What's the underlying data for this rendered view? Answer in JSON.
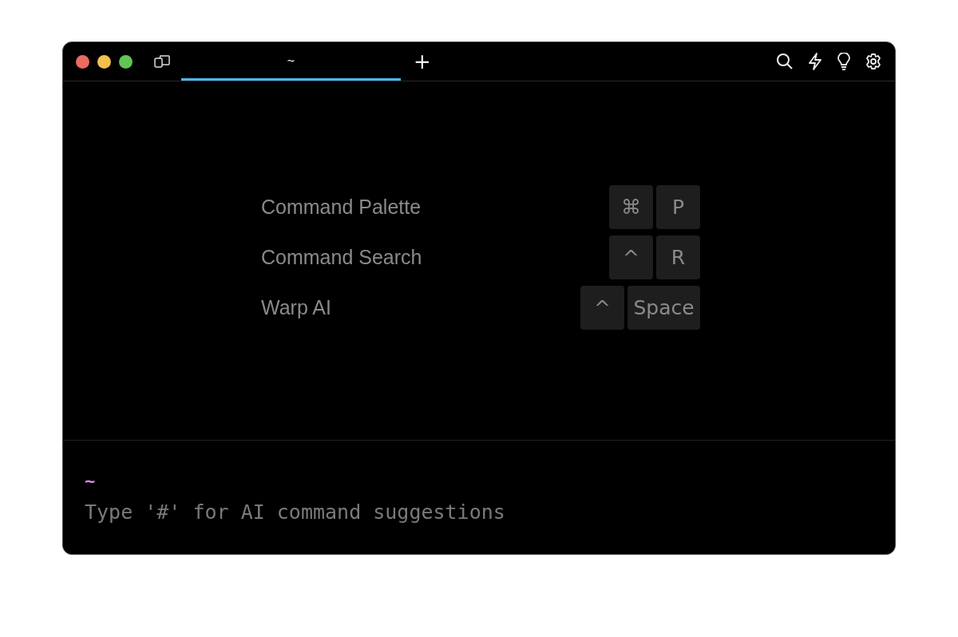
{
  "tabs": [
    {
      "label": "~",
      "selected": true
    }
  ],
  "new_tab": "+",
  "shortcuts": [
    {
      "label": "Command Palette",
      "keys": [
        "⌘",
        "P"
      ]
    },
    {
      "label": "Command Search",
      "keys": [
        "^",
        "R"
      ]
    },
    {
      "label": "Warp AI",
      "keys": [
        "^",
        "Space"
      ]
    }
  ],
  "prompt": {
    "directory": "~",
    "placeholder": "Type '#' for AI command suggestions"
  }
}
